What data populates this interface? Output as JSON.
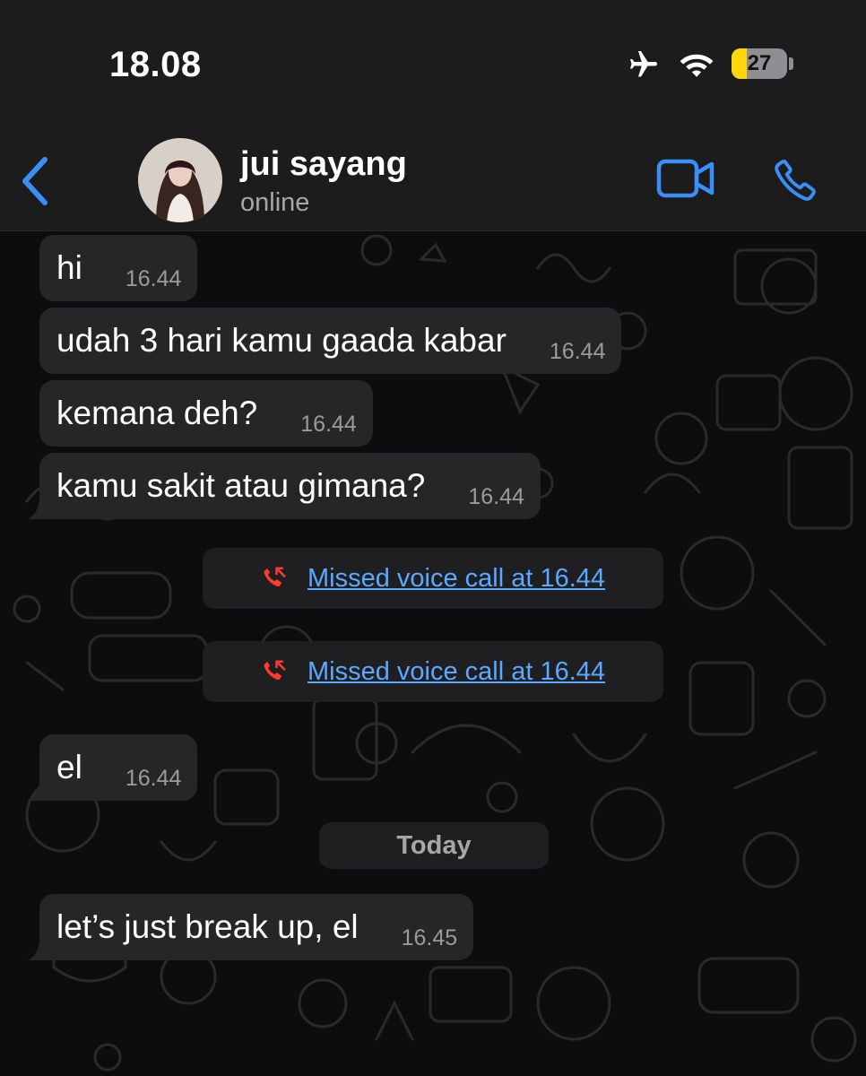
{
  "status_bar": {
    "time": "18.08",
    "battery_level": "27",
    "battery_fraction": 0.27,
    "icons": [
      "airplane-mode-icon",
      "wifi-icon",
      "battery-icon"
    ]
  },
  "header": {
    "back_icon": "chevron-left-icon",
    "contact_name": "jui sayang",
    "contact_status": "online",
    "actions": [
      "video-call-icon",
      "voice-call-icon"
    ],
    "accent_color": "#3a8ef6"
  },
  "messages": [
    {
      "text": "hi",
      "time": "16.44"
    },
    {
      "text": "udah 3 hari kamu gaada kabar",
      "time": "16.44"
    },
    {
      "text": "kemana deh?",
      "time": "16.44"
    },
    {
      "text": "kamu sakit atau gimana?",
      "time": "16.44"
    },
    {
      "text": "el",
      "time": "16.44"
    },
    {
      "text": "let’s just break up, el",
      "time": "16.45"
    }
  ],
  "calls": [
    {
      "text": "Missed voice call at 16.44",
      "icon": "missed-call-icon"
    },
    {
      "text": "Missed voice call at 16.44",
      "icon": "missed-call-icon"
    }
  ],
  "date_separator": "Today",
  "colors": {
    "bubble": "#262628",
    "link": "#5aa8ff",
    "missed_call": "#ff3b30",
    "battery_low": "#ffd60a"
  }
}
